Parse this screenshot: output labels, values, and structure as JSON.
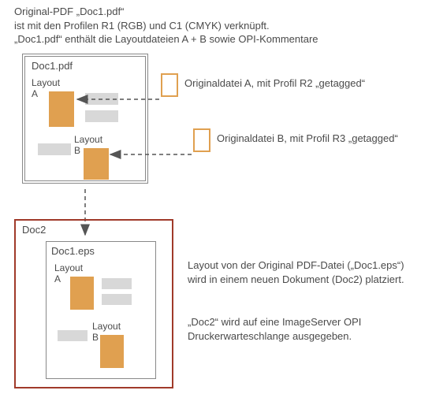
{
  "intro": {
    "l1": "Original-PDF „Doc1.pdf“",
    "l2": "ist mit den Profilen R1 (RGB) und C1 (CMYK) verknüpft.",
    "l3": "„Doc1.pdf“ enthält die Layoutdateien A + B sowie OPI-Kommentare"
  },
  "doc1": {
    "title": "Doc1.pdf",
    "layoutA": "Layout\nA",
    "layoutB": "Layout\nB"
  },
  "origA": "Originaldatei A, mit Profil R2 „getagged“",
  "origB": "Originaldatei B, mit Profil R3 „getagged“",
  "doc2": {
    "title": "Doc2",
    "inner": "Doc1.eps",
    "layoutA": "Layout\nA",
    "layoutB": "Layout\nB"
  },
  "right1": "Layout von der Original PDF-Datei („Doc1.eps“)\nwird in einem neuen Dokument (Doc2) platziert.",
  "right2": "„Doc2“ wird auf eine ImageServer OPI\nDruckerwarteschlange ausgegeben."
}
